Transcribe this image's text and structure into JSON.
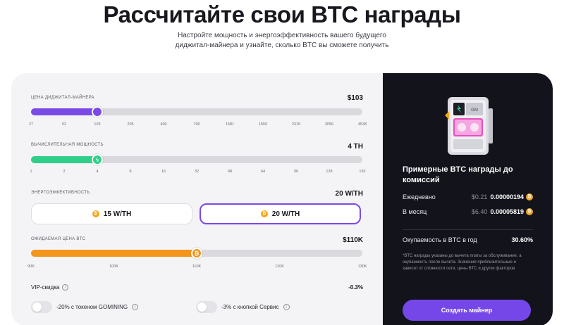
{
  "hero": {
    "title": "Рассчитайте свои BTC награды",
    "subtitle": "Настройте мощность и энергоэффективность вашего будущего диджитал-майнера и узнайте, сколько BTC вы сможете получить"
  },
  "colors": {
    "accent_purple": "#7a4ae6",
    "hashrate_green": "#2fcf8a",
    "btc_orange": "#f4951c",
    "panel_dark": "#13131c"
  },
  "price_slider": {
    "label": "ЦЕНА ДИДЖИТАЛ-МАЙНЕРА",
    "value": "$103",
    "ticks": [
      "27",
      "52",
      "103",
      "205",
      "400",
      "790",
      "1581",
      "1559",
      "2315",
      "3056",
      "4538"
    ],
    "position_fraction": 0.2
  },
  "power_slider": {
    "label": "ВЫЧИСЛИТЕЛЬНАЯ МОЩНОСТЬ",
    "value": "4 TH",
    "ticks": [
      "1",
      "2",
      "4",
      "8",
      "16",
      "32",
      "48",
      "64",
      "96",
      "128",
      "192"
    ],
    "position_fraction": 0.2,
    "thumb_icon": "lightning-icon"
  },
  "efficiency": {
    "label": "ЭНЕРГОЭФФЕКТИВНОСТЬ",
    "value": "20 W/TH",
    "options": [
      {
        "label": "15 W/TH",
        "selected": false
      },
      {
        "label": "20 W/TH",
        "selected": true
      }
    ]
  },
  "btc_price_slider": {
    "label": "ОЖИДАЕМАЯ ЦЕНА BTC",
    "value": "$110K",
    "ticks": [
      "90K",
      "100K",
      "110K",
      "120K",
      "130K"
    ],
    "position_fraction": 0.5
  },
  "vip": {
    "label": "VIP-скидка",
    "value": "-0.3%",
    "toggles": [
      {
        "label": "-20% с токеном GOMINING"
      },
      {
        "label": "-3% с кнопкой Сервис"
      }
    ]
  },
  "rewards": {
    "title": "Примерные BTC награды до комиссий",
    "daily": {
      "label": "Ежедневно",
      "usd": "$0.21",
      "btc": "0.00000194"
    },
    "monthly": {
      "label": "В месяц",
      "usd": "$6.40",
      "btc": "0.00005819"
    },
    "payback": {
      "label": "Окупаемость в BTC в год",
      "value": "30.60%"
    },
    "note": "*BTC награды указаны до вычета платы за обслуживание, а окупаемость после вычета. Значения приблизительные и зависят от сложности сети, цены BTC и других факторов",
    "cta": "Создать майнер"
  }
}
